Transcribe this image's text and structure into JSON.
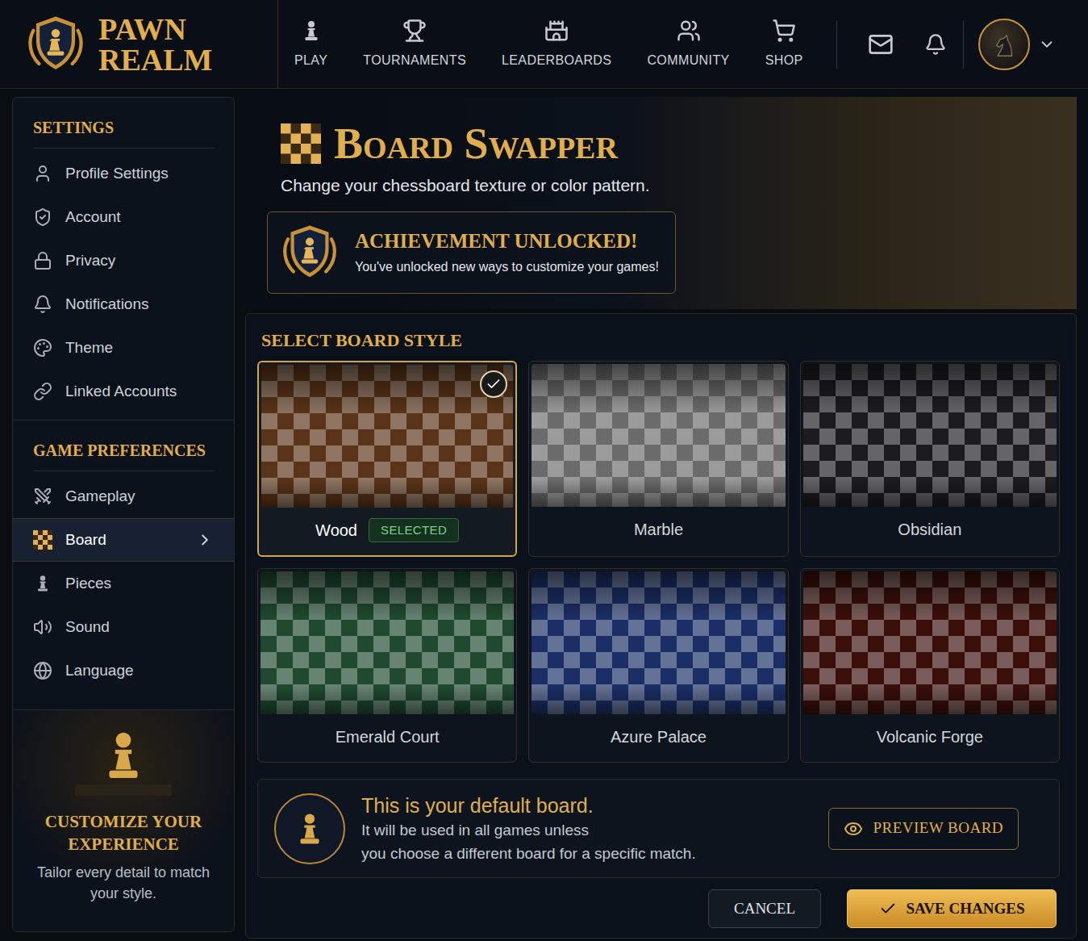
{
  "header": {
    "logo": {
      "line1": "PAWN",
      "line2": "REALM"
    },
    "nav": [
      {
        "label": "PLAY"
      },
      {
        "label": "TOURNAMENTS"
      },
      {
        "label": "LEADERBOARDS"
      },
      {
        "label": "COMMUNITY"
      },
      {
        "label": "SHOP"
      }
    ]
  },
  "sidebar": {
    "sections": [
      {
        "title": "SETTINGS",
        "items": [
          {
            "label": "Profile Settings",
            "selected": false
          },
          {
            "label": "Account",
            "selected": false
          },
          {
            "label": "Privacy",
            "selected": false
          },
          {
            "label": "Notifications",
            "selected": false
          },
          {
            "label": "Theme",
            "selected": false
          },
          {
            "label": "Linked Accounts",
            "selected": false
          }
        ]
      },
      {
        "title": "GAME PREFERENCES",
        "items": [
          {
            "label": "Gameplay",
            "selected": false
          },
          {
            "label": "Board",
            "selected": true
          },
          {
            "label": "Pieces",
            "selected": false
          },
          {
            "label": "Sound",
            "selected": false
          },
          {
            "label": "Language",
            "selected": false
          }
        ]
      }
    ],
    "promo": {
      "title": "CUSTOMIZE YOUR EXPERIENCE",
      "text": "Tailor every detail to match your style."
    }
  },
  "page": {
    "title": "Board Swapper",
    "subtitle": "Change your chessboard texture or color pattern."
  },
  "achievement": {
    "title": "ACHIEVEMENT UNLOCKED!",
    "text": "You've unlocked new ways to customize your games!"
  },
  "boards": {
    "heading": "SELECT BOARD STYLE",
    "badge": "SELECTED",
    "items": [
      {
        "name": "Wood",
        "selected": true,
        "color": "#5a3418"
      },
      {
        "name": "Marble",
        "selected": false,
        "color": "#6b6b6b"
      },
      {
        "name": "Obsidian",
        "selected": false,
        "color": "#1c1c20"
      },
      {
        "name": "Emerald Court",
        "selected": false,
        "color": "#1f4a30"
      },
      {
        "name": "Azure Palace",
        "selected": false,
        "color": "#1b2f66"
      },
      {
        "name": "Volcanic Forge",
        "selected": false,
        "color": "#3a0f0a"
      }
    ]
  },
  "default_info": {
    "title": "This is your default board.",
    "lines": [
      "It will be used in all games unless",
      "you choose a different board for a specific match."
    ],
    "preview": "PREVIEW BOARD"
  },
  "buttons": {
    "cancel": "CANCEL",
    "save": "SAVE CHANGES"
  }
}
